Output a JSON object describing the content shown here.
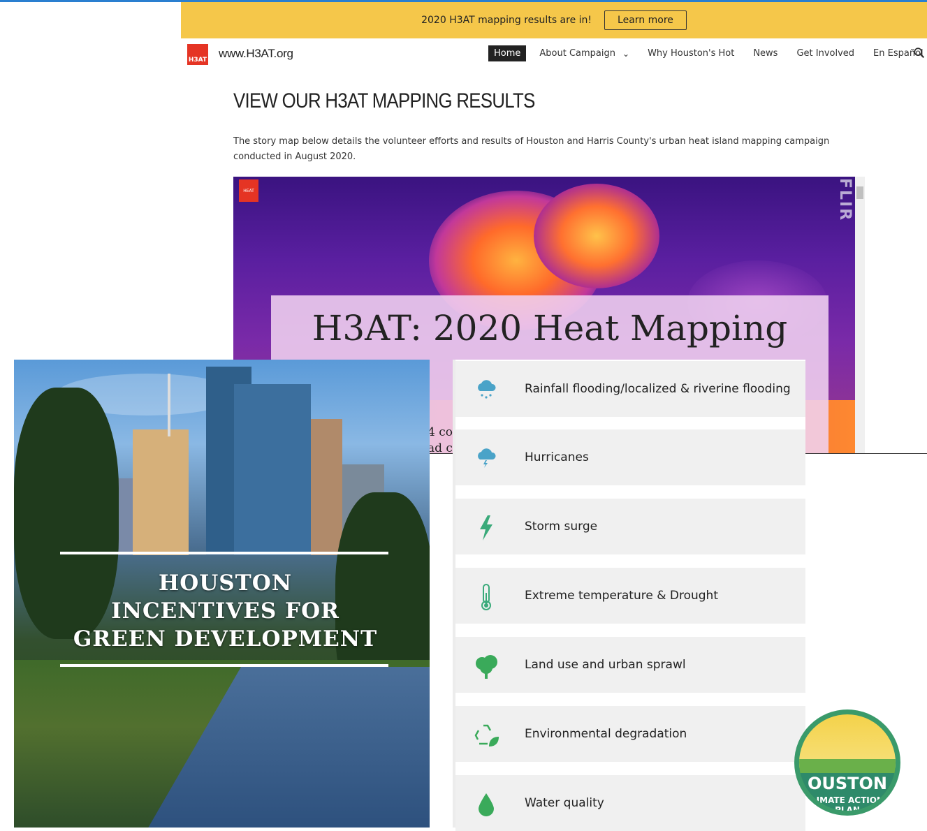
{
  "banner": {
    "text": "2020 H3AT mapping results are in!",
    "button": "Learn more"
  },
  "header": {
    "site_name": "www.H3AT.org",
    "logo_text": "H3AT"
  },
  "nav": {
    "items": [
      {
        "label": "Home"
      },
      {
        "label": "About Campaign"
      },
      {
        "label": "Why Houston's Hot"
      },
      {
        "label": "News"
      },
      {
        "label": "Get Involved"
      },
      {
        "label": "En Español"
      }
    ]
  },
  "main": {
    "title": "VIEW OUR H3AT MAPPING RESULTS",
    "intro": "The story map below details the volunteer efforts and results of Houston and Harris County's urban heat island mapping campaign conducted in August 2020.",
    "storymap": {
      "title": "H3AT: 2020 Heat Mapping",
      "logo_text": "HEAT",
      "brand": "FLIR",
      "snippet_line1": "4 co",
      "snippet_line2": "ad c"
    }
  },
  "hero": {
    "line1": "HOUSTON",
    "line2": "INCENTIVES FOR",
    "line3": "GREEN DEVELOPMENT"
  },
  "hazards": [
    {
      "label": "Rainfall flooding/localized & riverine flooding",
      "icon": "rain-cloud-icon",
      "color": "#4aa3c8"
    },
    {
      "label": "Hurricanes",
      "icon": "storm-cloud-icon",
      "color": "#4aa3c8"
    },
    {
      "label": "Storm surge",
      "icon": "lightning-icon",
      "color": "#3aaa7a"
    },
    {
      "label": "Extreme temperature & Drought",
      "icon": "thermometer-icon",
      "color": "#3aaa7a"
    },
    {
      "label": "Land use and urban sprawl",
      "icon": "tree-icon",
      "color": "#3aaa5a"
    },
    {
      "label": "Environmental degradation",
      "icon": "recycle-leaf-icon",
      "color": "#3aaa5a"
    },
    {
      "label": "Water quality",
      "icon": "water-drop-icon",
      "color": "#3aaa5a"
    }
  ],
  "badge": {
    "main": "OUSTON",
    "sub1": "LIMATE ACTION",
    "sub2": "PLAN"
  },
  "colors": {
    "banner": "#f5c74a",
    "accent_red": "#e53424",
    "top_line": "#2a7fd0"
  }
}
